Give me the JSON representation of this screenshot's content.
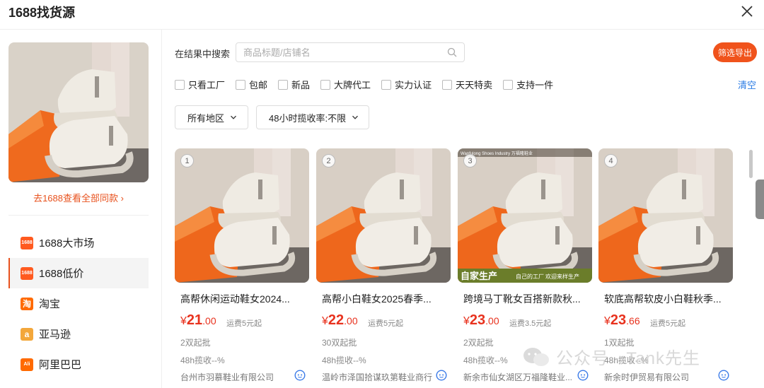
{
  "header": {
    "title": "1688找货源"
  },
  "left": {
    "see_all": "去1688查看全部同款 ›",
    "sources": [
      {
        "label": "1688大市场",
        "logo_text": "1688",
        "color": "#ff5a1f"
      },
      {
        "label": "1688低价",
        "logo_text": "1688",
        "color": "#ff5a1f"
      },
      {
        "label": "淘宝",
        "logo_text": "淘",
        "color": "#ff6a00"
      },
      {
        "label": "亚马逊",
        "logo_text": "a",
        "color": "#f3a73b"
      },
      {
        "label": "阿里巴巴",
        "logo_text": "Ali",
        "color": "#ff6a00"
      }
    ]
  },
  "search": {
    "label": "在结果中搜索",
    "placeholder": "商品标题/店铺名",
    "export_label": "筛选导出"
  },
  "filters": {
    "checkboxes": [
      "只看工厂",
      "包邮",
      "新品",
      "大牌代工",
      "实力认证",
      "天天特卖",
      "支持一件"
    ],
    "clear_label": "清空",
    "region": "所有地区",
    "rate": "48小时揽收率:不限"
  },
  "products": [
    {
      "index": "1",
      "name": "高帮休闲运动鞋女2024...",
      "currency": "¥",
      "price_int": "21",
      "price_dec": ".00",
      "shipping": "运费5元起",
      "moq": "2双起批",
      "rate": "48h揽收--%",
      "store": "台州市羽慕鞋业有限公司"
    },
    {
      "index": "2",
      "name": "高帮小白鞋女2025春季...",
      "currency": "¥",
      "price_int": "22",
      "price_dec": ".00",
      "shipping": "运费5元起",
      "moq": "30双起批",
      "rate": "48h揽收--%",
      "store": "温岭市泽国拾谋玖第鞋业商行"
    },
    {
      "index": "3",
      "name": "跨境马丁靴女百搭新款秋...",
      "currency": "¥",
      "price_int": "23",
      "price_dec": ".00",
      "shipping": "运费3.5元起",
      "moq": "2双起批",
      "rate": "48h揽收--%",
      "store": "新余市仙女湖区万福隆鞋业...",
      "brand": "Wanfulong Shoes Industry 万福隆鞋业",
      "banner_left": "自家生产",
      "banner_right": "自己的工厂 欢迎来样生产"
    },
    {
      "index": "4",
      "name": "软底高帮软皮小白鞋秋季...",
      "currency": "¥",
      "price_int": "23",
      "price_dec": ".66",
      "shipping": "运费5元起",
      "moq": "1双起批",
      "rate": "48h揽收--%",
      "store": "新余时伊贸易有限公司"
    }
  ],
  "watermark": "公众号 · Tank先生",
  "colors": {
    "accent": "#f0531c",
    "price": "#e8321e",
    "link": "#2a7be4"
  }
}
